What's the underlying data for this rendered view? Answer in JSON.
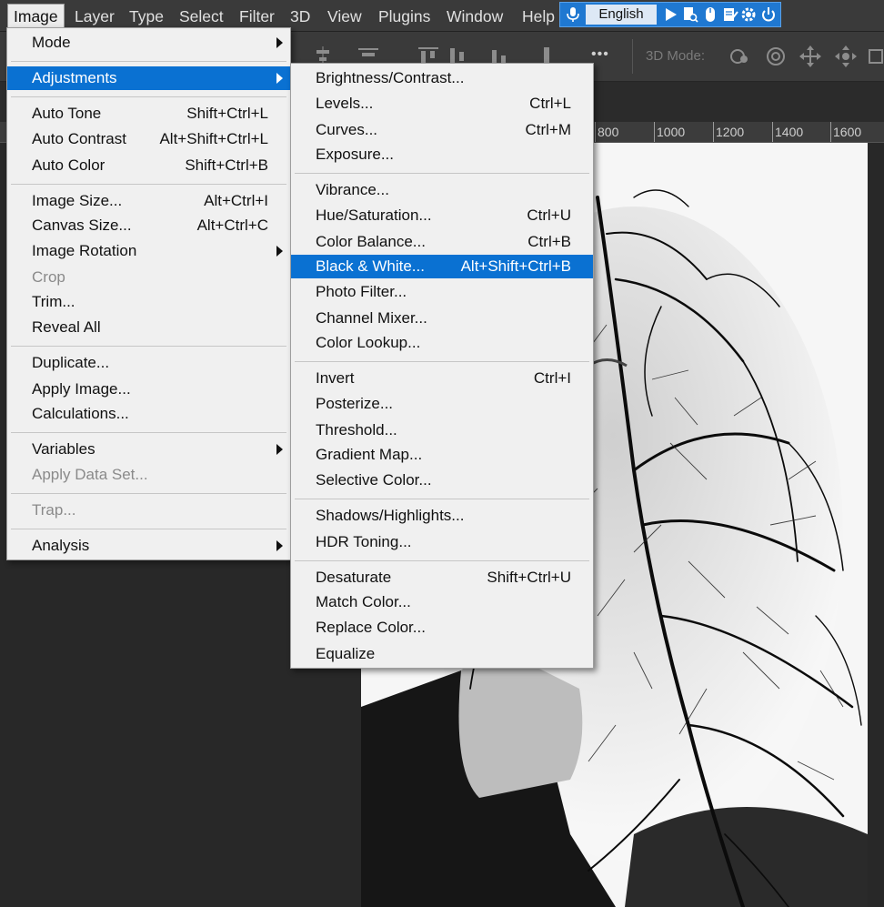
{
  "menubar": {
    "items": [
      "Image",
      "Layer",
      "Type",
      "Select",
      "Filter",
      "3D",
      "View",
      "Plugins",
      "Window",
      "Help"
    ],
    "active": "Image"
  },
  "ime_toolbar": {
    "language": "English",
    "icons": [
      "microphone-icon",
      "play-icon",
      "document-search-icon",
      "mouse-icon",
      "edit-document-icon",
      "gear-icon",
      "power-icon"
    ]
  },
  "options_bar": {
    "more_label": "•••",
    "mode_3d_label": "3D Mode:"
  },
  "ruler": {
    "ticks": [
      "800",
      "1000",
      "1200",
      "1400",
      "1600"
    ]
  },
  "image_menu": {
    "items": [
      {
        "label": "Mode",
        "shortcut": "",
        "submenu": true
      },
      {
        "label": "Adjustments",
        "shortcut": "",
        "submenu": true,
        "highlighted": true
      },
      {
        "label": "Auto Tone",
        "shortcut": "Shift+Ctrl+L"
      },
      {
        "label": "Auto Contrast",
        "shortcut": "Alt+Shift+Ctrl+L"
      },
      {
        "label": "Auto Color",
        "shortcut": "Shift+Ctrl+B"
      },
      {
        "label": "Image Size...",
        "shortcut": "Alt+Ctrl+I"
      },
      {
        "label": "Canvas Size...",
        "shortcut": "Alt+Ctrl+C"
      },
      {
        "label": "Image Rotation",
        "shortcut": "",
        "submenu": true
      },
      {
        "label": "Crop",
        "shortcut": "",
        "disabled": true
      },
      {
        "label": "Trim...",
        "shortcut": ""
      },
      {
        "label": "Reveal All",
        "shortcut": ""
      },
      {
        "label": "Duplicate...",
        "shortcut": ""
      },
      {
        "label": "Apply Image...",
        "shortcut": ""
      },
      {
        "label": "Calculations...",
        "shortcut": ""
      },
      {
        "label": "Variables",
        "shortcut": "",
        "submenu": true
      },
      {
        "label": "Apply Data Set...",
        "shortcut": "",
        "disabled": true
      },
      {
        "label": "Trap...",
        "shortcut": "",
        "disabled": true
      },
      {
        "label": "Analysis",
        "shortcut": "",
        "submenu": true
      }
    ]
  },
  "adjustments_menu": {
    "items": [
      {
        "label": "Brightness/Contrast...",
        "shortcut": ""
      },
      {
        "label": "Levels...",
        "shortcut": "Ctrl+L"
      },
      {
        "label": "Curves...",
        "shortcut": "Ctrl+M"
      },
      {
        "label": "Exposure...",
        "shortcut": ""
      },
      {
        "label": "Vibrance...",
        "shortcut": ""
      },
      {
        "label": "Hue/Saturation...",
        "shortcut": "Ctrl+U"
      },
      {
        "label": "Color Balance...",
        "shortcut": "Ctrl+B"
      },
      {
        "label": "Black & White...",
        "shortcut": "Alt+Shift+Ctrl+B",
        "highlighted": true
      },
      {
        "label": "Photo Filter...",
        "shortcut": ""
      },
      {
        "label": "Channel Mixer...",
        "shortcut": ""
      },
      {
        "label": "Color Lookup...",
        "shortcut": ""
      },
      {
        "label": "Invert",
        "shortcut": "Ctrl+I"
      },
      {
        "label": "Posterize...",
        "shortcut": ""
      },
      {
        "label": "Threshold...",
        "shortcut": ""
      },
      {
        "label": "Gradient Map...",
        "shortcut": ""
      },
      {
        "label": "Selective Color...",
        "shortcut": ""
      },
      {
        "label": "Shadows/Highlights...",
        "shortcut": ""
      },
      {
        "label": "HDR Toning...",
        "shortcut": ""
      },
      {
        "label": "Desaturate",
        "shortcut": "Shift+Ctrl+U"
      },
      {
        "label": "Match Color...",
        "shortcut": ""
      },
      {
        "label": "Replace Color...",
        "shortcut": ""
      },
      {
        "label": "Equalize",
        "shortcut": ""
      }
    ]
  },
  "colors": {
    "highlight": "#0a71d2",
    "menu_bg": "#f0f0f0",
    "app_bg": "#282828",
    "ime_bar": "#1f78d1"
  }
}
